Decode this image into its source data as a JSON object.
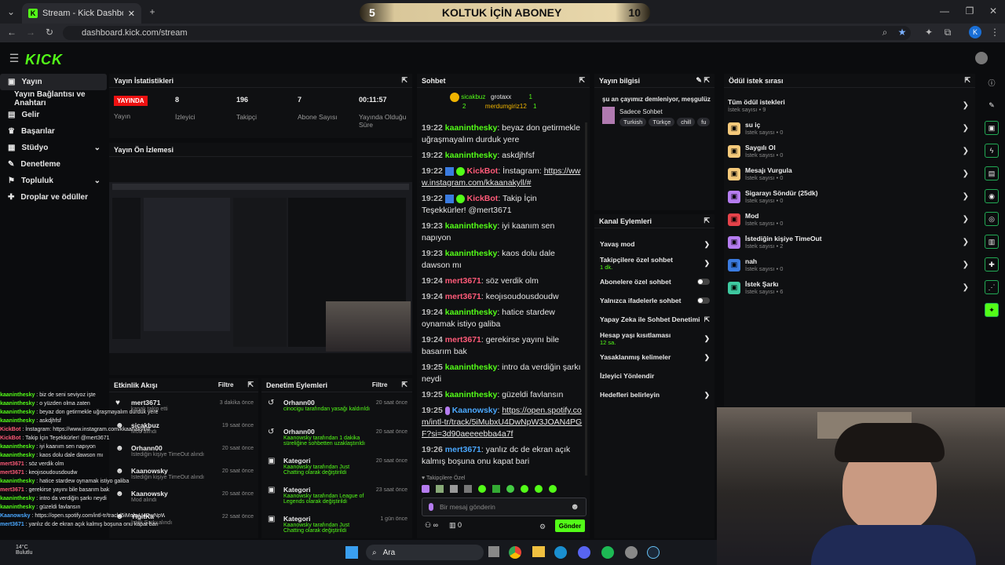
{
  "browser": {
    "tab_title": "Stream - Kick Dashboard",
    "url": "dashboard.kick.com/stream",
    "profile_letter": "K"
  },
  "banner": {
    "left_num": "5",
    "text": "KOLTUK İÇİN ABONEY",
    "right_num": "10"
  },
  "logo": "KICK",
  "sidebar": {
    "items": [
      {
        "label": "Yayın"
      },
      {
        "label": "Yayın Bağlantısı ve Anahtarı"
      },
      {
        "label": "Gelir"
      },
      {
        "label": "Başarılar"
      },
      {
        "label": "Stüdyo"
      },
      {
        "label": "Denetleme"
      },
      {
        "label": "Topluluk"
      },
      {
        "label": "Droplar ve ödüller"
      }
    ]
  },
  "stats": {
    "title": "Yayın İstatistikleri",
    "live": "YAYINDA",
    "stream_label": "Yayın",
    "viewers": "8",
    "viewers_label": "İzleyici",
    "followers": "196",
    "followers_label": "Takipçi",
    "subs": "7",
    "subs_label": "Abone Sayısı",
    "uptime": "00:11:57",
    "uptime_label": "Yayında Olduğu Süre"
  },
  "preview": {
    "title": "Yayın Ön İzlemesi"
  },
  "activity": {
    "title": "Etkinlik Akışı",
    "filter": "Filtre",
    "items": [
      {
        "name": "mert3671",
        "desc": "kanalı takip etti",
        "time": "3 dakika önce"
      },
      {
        "name": "sicakbuz",
        "desc": "Mod alındı",
        "time": "19 saat önce"
      },
      {
        "name": "Orhann00",
        "desc": "İstediğin kişiye TimeOut alındı",
        "time": "20 saat önce"
      },
      {
        "name": "Kaanowsky",
        "desc": "İstediğin kişiye TimeOut alındı",
        "time": "20 saat önce"
      },
      {
        "name": "Kaanowsky",
        "desc": "Mod alındı",
        "time": "20 saat önce"
      },
      {
        "name": "YigitKa",
        "desc": "İstek Şarkı alındı",
        "time": "22 saat önce"
      }
    ]
  },
  "moderation": {
    "title": "Denetim Eylemleri",
    "filter": "Filtre",
    "items": [
      {
        "name": "Orhann00",
        "desc": "cinocigu tarafından yasağı kaldırıldı",
        "time": "20 saat önce"
      },
      {
        "name": "Orhann00",
        "desc": "Kaanowsky tarafından 1 dakika süreliğine sohbetten uzaklaştırıldı",
        "time": "20 saat önce"
      },
      {
        "name": "Kategori",
        "desc": "Kaanowsky tarafından Just Chatting olarak değiştirildi",
        "time": "20 saat önce"
      },
      {
        "name": "Kategori",
        "desc": "Kaanowsky tarafından League of Legends olarak değiştirildi",
        "time": "23 saat önce"
      },
      {
        "name": "Kategori",
        "desc": "Kaanowsky tarafından Just Chatting olarak değiştirildi",
        "time": "1 gün önce"
      }
    ]
  },
  "chat": {
    "title": "Sohbet",
    "top": {
      "user1": "sicakbuz",
      "count1": "2",
      "user2": "grotaxx",
      "count2": "1",
      "user3": "merdumgiriz12",
      "count3": "1"
    },
    "messages": [
      {
        "time": "19:22",
        "user": "kaaninthesky",
        "cls": "ug",
        "text": "beyaz don getirmekle uğraşmayalım durduk yere"
      },
      {
        "time": "19:22",
        "user": "kaaninthesky",
        "cls": "ug",
        "text": "askdjhfsf"
      },
      {
        "time": "19:22",
        "user": "KickBot",
        "cls": "ur",
        "text": "İnstagram: ",
        "link": "https://www.instagram.com/kkaanakyll/#"
      },
      {
        "time": "19:22",
        "user": "KickBot",
        "cls": "ur",
        "text": "Takip İçin Teşekkürler! @mert3671"
      },
      {
        "time": "19:23",
        "user": "kaaninthesky",
        "cls": "ug",
        "text": "iyi kaanım sen napıyon"
      },
      {
        "time": "19:23",
        "user": "kaaninthesky",
        "cls": "ug",
        "text": "kaos dolu dale dawson mı"
      },
      {
        "time": "19:24",
        "user": "mert3671",
        "cls": "ur",
        "text": "söz verdik olm"
      },
      {
        "time": "19:24",
        "user": "mert3671",
        "cls": "ur",
        "text": "keojısoudousdoudw"
      },
      {
        "time": "19:24",
        "user": "kaaninthesky",
        "cls": "ug",
        "text": "hatice stardew oynamak istiyo galiba"
      },
      {
        "time": "19:24",
        "user": "mert3671",
        "cls": "ur",
        "text": "gerekirse yayını bile basarım bak"
      },
      {
        "time": "19:25",
        "user": "kaaninthesky",
        "cls": "ug",
        "text": "intro da verdiğin şarkı neydi"
      },
      {
        "time": "19:25",
        "user": "kaaninthesky",
        "cls": "ug",
        "text": "güzeldi favlansın"
      },
      {
        "time": "19:25",
        "user": "Kaanowsky",
        "cls": "ub",
        "text": "",
        "link": "https://open.spotify.com/intl-tr/track/5iMubxU4DwNpW3JOAN4PGF?si=3d90aeeeebba4a7f"
      },
      {
        "time": "19:26",
        "user": "mert3671",
        "cls": "ub",
        "text": "yanlız dc de ekran açık kalmış boşuna onu kapat bari"
      }
    ],
    "followers_only": "Takipçilere Özel",
    "placeholder": "Bir mesaj gönderin",
    "send": "Gönder",
    "infinity": "∞",
    "zero": "0"
  },
  "stream_info": {
    "title": "Yayın bilgisi",
    "stream_title": "şu an çayımız demleniyor, meşgulüz",
    "category": "Sadece Sohbet",
    "tags": [
      "Turkish",
      "Türkçe",
      "chill",
      "fu"
    ]
  },
  "channel_actions": {
    "title": "Kanal Eylemleri",
    "items": [
      {
        "label": "Yavaş mod",
        "sub": "",
        "kind": "chev"
      },
      {
        "label": "Takipçilere özel sohbet",
        "sub": "1 dk.",
        "kind": "chev"
      },
      {
        "label": "Abonelere özel sohbet",
        "sub": "",
        "kind": "toggle"
      },
      {
        "label": "Yalnızca ifadelerle sohbet",
        "sub": "",
        "kind": "toggle"
      },
      {
        "label": "Yapay Zeka ile Sohbet Denetimi",
        "sub": "",
        "kind": "ext"
      },
      {
        "label": "Hesap yaşı kısıtlaması",
        "sub": "12 sa.",
        "kind": "chev"
      },
      {
        "label": "Yasaklanmış kelimeler",
        "sub": "",
        "kind": "chev"
      },
      {
        "label": "İzleyici Yönlendir",
        "sub": "",
        "kind": "none"
      },
      {
        "label": "Hedefleri belirleyin",
        "sub": "",
        "kind": "chev"
      }
    ]
  },
  "rewards": {
    "title": "Ödül istek sırası",
    "all": "Tüm ödül istekleri",
    "all_count": "İstek sayısı • 9",
    "items": [
      {
        "label": "su iç",
        "count": "İstek sayısı • 0",
        "color": "#f5c97a"
      },
      {
        "label": "Saygılı Ol",
        "count": "İstek sayısı • 0",
        "color": "#f5c97a"
      },
      {
        "label": "Mesajı Vurgula",
        "count": "İstek sayısı • 0",
        "color": "#f5c97a"
      },
      {
        "label": "Sigarayı Söndür (25dk)",
        "count": "İstek sayısı • 0",
        "color": "#b57cf0"
      },
      {
        "label": "Mod",
        "count": "İstek sayısı • 0",
        "color": "#e5424a"
      },
      {
        "label": "İstediğin kişiye TimeOut",
        "count": "İstek sayısı • 2",
        "color": "#b57cf0"
      },
      {
        "label": "nah",
        "count": "İstek sayısı • 0",
        "color": "#3a7be0"
      },
      {
        "label": "İstek Şarkı",
        "count": "İstek sayısı • 6",
        "color": "#3ec9a0"
      }
    ]
  },
  "overlay": [
    {
      "u": "kaaninthesky",
      "c": "#53fc18",
      "t": "biz de seni seviyoz işte"
    },
    {
      "u": "kaaninthesky",
      "c": "#53fc18",
      "t": "o yüzden olma zaten"
    },
    {
      "u": "kaaninthesky",
      "c": "#53fc18",
      "t": "beyaz don getirmekle uğraşmayalım durduk yere"
    },
    {
      "u": "kaaninthesky",
      "c": "#53fc18",
      "t": "askdjhfsf"
    },
    {
      "u": "KickBot",
      "c": "#ff5a78",
      "t": "İnstagram: https://www.instagram.com/kkaanakyll/#"
    },
    {
      "u": "KickBot",
      "c": "#ff5a78",
      "t": "Takip İçin Teşekkürler! @mert3671"
    },
    {
      "u": "kaaninthesky",
      "c": "#53fc18",
      "t": "iyi kaanım sen napıyon"
    },
    {
      "u": "kaaninthesky",
      "c": "#53fc18",
      "t": "kaos dolu dale dawson mı"
    },
    {
      "u": "mert3671",
      "c": "#ff5a78",
      "t": "söz verdik olm"
    },
    {
      "u": "mert3671",
      "c": "#ff5a78",
      "t": "keojısoudousdoudw"
    },
    {
      "u": "kaaninthesky",
      "c": "#53fc18",
      "t": "hatice stardew oynamak istiyo galiba"
    },
    {
      "u": "mert3671",
      "c": "#ff5a78",
      "t": "gerekirse yayını bile basarım bak"
    },
    {
      "u": "kaaninthesky",
      "c": "#53fc18",
      "t": "intro da verdiğin şarkı neydi"
    },
    {
      "u": "kaaninthesky",
      "c": "#53fc18",
      "t": "güzeldi favlansın"
    },
    {
      "u": "Kaanowsky",
      "c": "#4aa8ff",
      "t": "https://open.spotify.com/intl-tr/track/5iMubxU4DwNpW3JOAN4PGF?si=3d90aeeeebba4a7f"
    },
    {
      "u": "mert3671",
      "c": "#4aa8ff",
      "t": "yanlız dc de ekran açık kalmış boşuna onu kapat bari"
    }
  ],
  "taskbar": {
    "search": "Ara",
    "weather": "14°C",
    "weather_desc": "Bulutlu"
  }
}
